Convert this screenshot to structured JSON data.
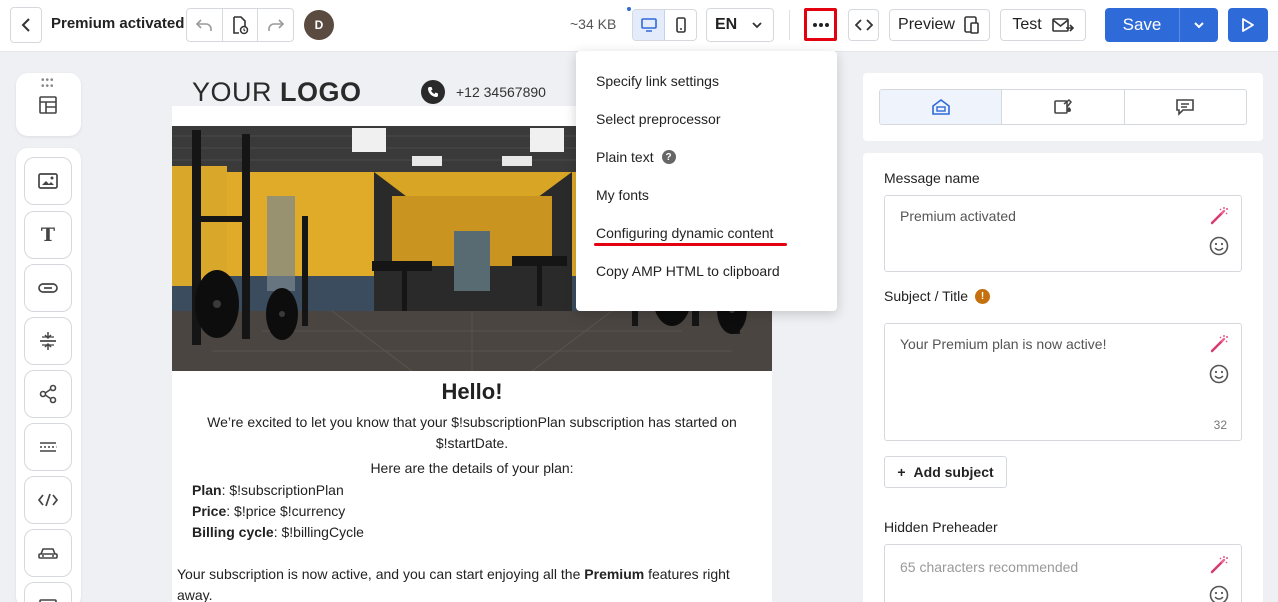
{
  "header": {
    "title": "Premium activated",
    "avatar_initial": "D",
    "size": "~34 KB",
    "language": "EN",
    "preview_label": "Preview",
    "test_label": "Test",
    "save_label": "Save"
  },
  "canvas": {
    "logo_light": "YOUR ",
    "logo_bold": "LOGO",
    "phone": "+12 34567890",
    "heading": "Hello!",
    "intro": "We’re excited to let you know that your $!subscriptionPlan subscription has started on $!startDate.",
    "details_intro": "Here are the details of your plan:",
    "details": [
      {
        "label": "Plan",
        "value": ": $!subscriptionPlan"
      },
      {
        "label": "Price",
        "value": ": $!price $!currency"
      },
      {
        "label": "Billing cycle",
        "value": ": $!billingCycle"
      }
    ],
    "closing_before": "Your subscription is now active, and you can start enjoying all the ",
    "closing_bold": "Premium",
    "closing_after": " features right away."
  },
  "menu": {
    "items": [
      {
        "label": "Specify link settings"
      },
      {
        "label": "Select preprocessor"
      },
      {
        "label": "Plain text"
      },
      {
        "label": "My fonts"
      },
      {
        "label": "Configuring dynamic content"
      },
      {
        "label": "Copy AMP HTML to clipboard"
      }
    ]
  },
  "settings": {
    "message_name_label": "Message name",
    "message_name_value": "Premium activated",
    "subject_label": "Subject / Title",
    "subject_value": "Your Premium plan is now active!",
    "subject_count": "32",
    "add_subject_label": "Add subject",
    "preheader_label": "Hidden Preheader",
    "preheader_placeholder": "65 characters recommended"
  },
  "colors": {
    "accent": "#2e6ad8",
    "highlight_red": "#e3000f",
    "warning": "#c5700f"
  }
}
